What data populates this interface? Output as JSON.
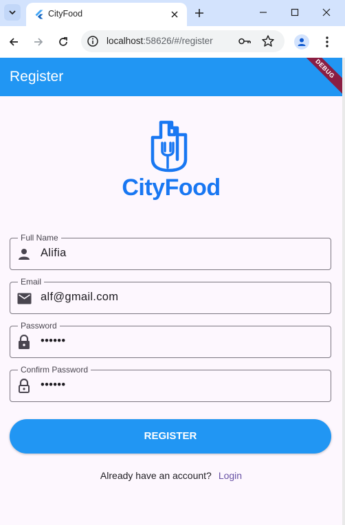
{
  "browser": {
    "tab_title": "CityFood",
    "url_host": "localhost",
    "url_rest": ":58626/#/register"
  },
  "app": {
    "title": "Register",
    "debug_banner": "DEBUG",
    "brand_name": "CityFood",
    "brand_color": "#1877f2",
    "primary_color": "#2196f3"
  },
  "form": {
    "full_name": {
      "label": "Full Name",
      "value": "Alifia",
      "icon": "person-icon"
    },
    "email": {
      "label": "Email",
      "value": "alf@gmail.com",
      "icon": "mail-icon"
    },
    "password": {
      "label": "Password",
      "value": "••••••",
      "icon": "lock-icon"
    },
    "confirm_password": {
      "label": "Confirm Password",
      "value": "••••••",
      "icon": "lock-open-icon"
    },
    "submit_label": "REGISTER"
  },
  "footer": {
    "prompt": "Already have an account?",
    "login_label": "Login"
  }
}
